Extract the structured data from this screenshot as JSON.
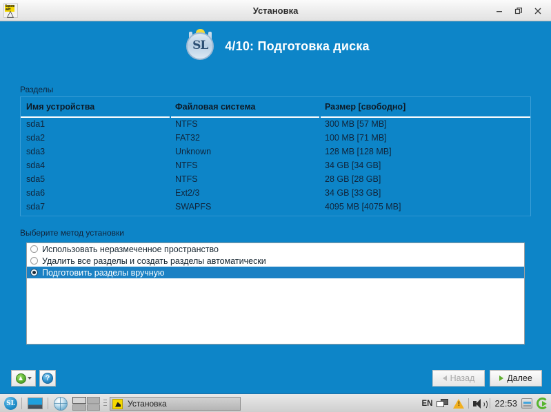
{
  "window": {
    "title": "Установка",
    "icon_name": "basealt-logo-icon",
    "buttons": {
      "minimize": "minimize-icon",
      "restore": "restore-icon",
      "close": "close-icon"
    }
  },
  "header": {
    "logo": "sl-logo",
    "logo_text": "SL",
    "step_title": "4/10: Подготовка диска"
  },
  "partitions": {
    "label": "Разделы",
    "columns": [
      "Имя устройства",
      "Файловая система",
      "Размер [свободно]"
    ],
    "rows": [
      {
        "device": "sda1",
        "fs": "NTFS",
        "size": "300 MB [57 MB]"
      },
      {
        "device": "sda2",
        "fs": "FAT32",
        "size": "100 MB [71 MB]"
      },
      {
        "device": "sda3",
        "fs": "Unknown",
        "size": "128 MB [128 MB]"
      },
      {
        "device": "sda4",
        "fs": "NTFS",
        "size": "34 GB [34 GB]"
      },
      {
        "device": "sda5",
        "fs": "NTFS",
        "size": "28 GB [28 GB]"
      },
      {
        "device": "sda6",
        "fs": "Ext2/3",
        "size": "34 GB [33 GB]"
      },
      {
        "device": "sda7",
        "fs": "SWAPFS",
        "size": "4095 MB [4075 MB]"
      }
    ]
  },
  "method": {
    "label": "Выберите метод установки",
    "options": [
      {
        "label": "Использовать неразмеченное пространство",
        "selected": false
      },
      {
        "label": "Удалить все разделы и создать разделы автоматически",
        "selected": false
      },
      {
        "label": "Подготовить разделы вручную",
        "selected": true
      }
    ]
  },
  "toolbar": {
    "expert_label": "",
    "expert_icon": "green-up-arrow-icon",
    "help_label": "?",
    "help_icon": "help-icon",
    "back_label": "Назад",
    "next_label": "Далее"
  },
  "taskbar": {
    "launcher_text": "SL",
    "show_desktop": "show-desktop-icon",
    "browser": "globe-icon",
    "task_label": "Установка",
    "tray": {
      "keyboard_layout": "EN",
      "display_icon": "displays-icon",
      "warning_icon": "warning-icon",
      "volume_icon": "volume-icon",
      "clock": "22:53",
      "updates_icon": "updates-icon",
      "logout_icon": "logout-icon"
    }
  },
  "colors": {
    "accent_blue": "#0d85c8",
    "selection_blue": "#1b81c4",
    "green": "#56b52e",
    "warning": "#f2b01e"
  }
}
